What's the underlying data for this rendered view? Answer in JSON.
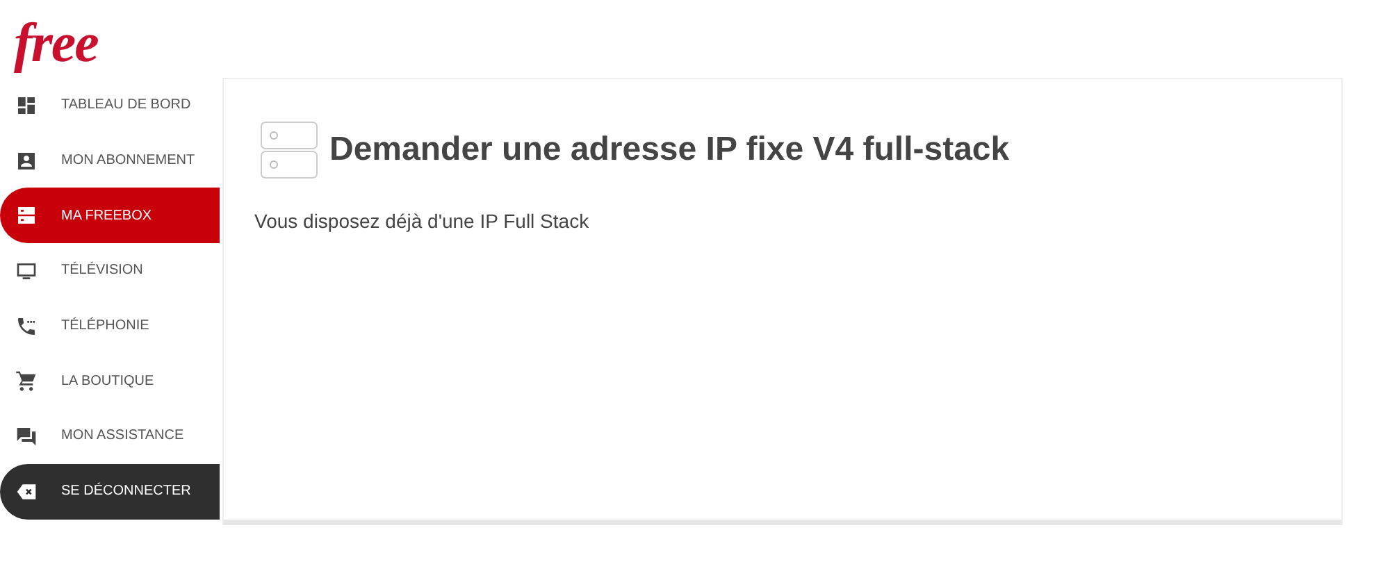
{
  "logo": "free",
  "sidebar": {
    "items": [
      {
        "label": "TABLEAU DE BORD",
        "kind": "nav",
        "selected": false
      },
      {
        "label": "MON ABONNEMENT",
        "kind": "nav",
        "selected": false
      },
      {
        "label": "MA FREEBOX",
        "kind": "nav",
        "selected": true
      },
      {
        "label": "TÉLÉVISION",
        "kind": "nav",
        "selected": false
      },
      {
        "label": "TÉLÉPHONIE",
        "kind": "nav",
        "selected": false
      },
      {
        "label": "LA BOUTIQUE",
        "kind": "nav",
        "selected": false
      },
      {
        "label": "MON ASSISTANCE",
        "kind": "nav",
        "selected": false
      },
      {
        "label": "SE DÉCONNECTER",
        "kind": "logout"
      }
    ]
  },
  "card": {
    "title": "Demander une adresse IP fixe V4 full-stack",
    "message": "Vous disposez déjà d'une IP Full Stack"
  }
}
